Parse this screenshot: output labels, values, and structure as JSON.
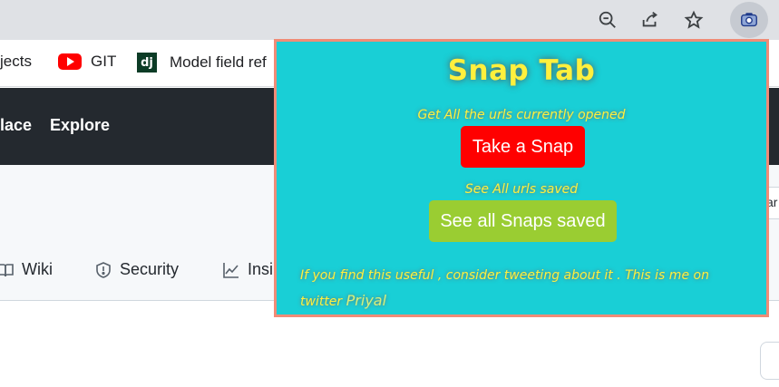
{
  "toolbar": {
    "icons": [
      "zoom-out-icon",
      "share-icon",
      "star-icon",
      "camera-extension-icon"
    ]
  },
  "bookmarks": {
    "items": [
      {
        "label": "jects"
      },
      {
        "label": "GIT",
        "icon": "youtube-icon"
      },
      {
        "label": "Model field ref",
        "icon": "django-icon"
      }
    ]
  },
  "github": {
    "nav": [
      "lace",
      "Explore"
    ],
    "repo_tabs": [
      "Wiki",
      "Security",
      "Insi"
    ],
    "right_field": "ar"
  },
  "popup": {
    "title": "Snap Tab",
    "snap_hint": "Get All the urls currently opened",
    "snap_button": "Take a Snap",
    "saved_hint": "See All urls saved",
    "saved_button": "See all Snaps saved",
    "footer_text": "If you find this useful , consider tweeting about it . This is me on twitter",
    "footer_link": "Priyal",
    "colors": {
      "background": "#19cfd6",
      "border": "#f08c77",
      "text": "#fff03d",
      "snap_button": "#ff0000",
      "saved_button": "#9acd32"
    }
  }
}
